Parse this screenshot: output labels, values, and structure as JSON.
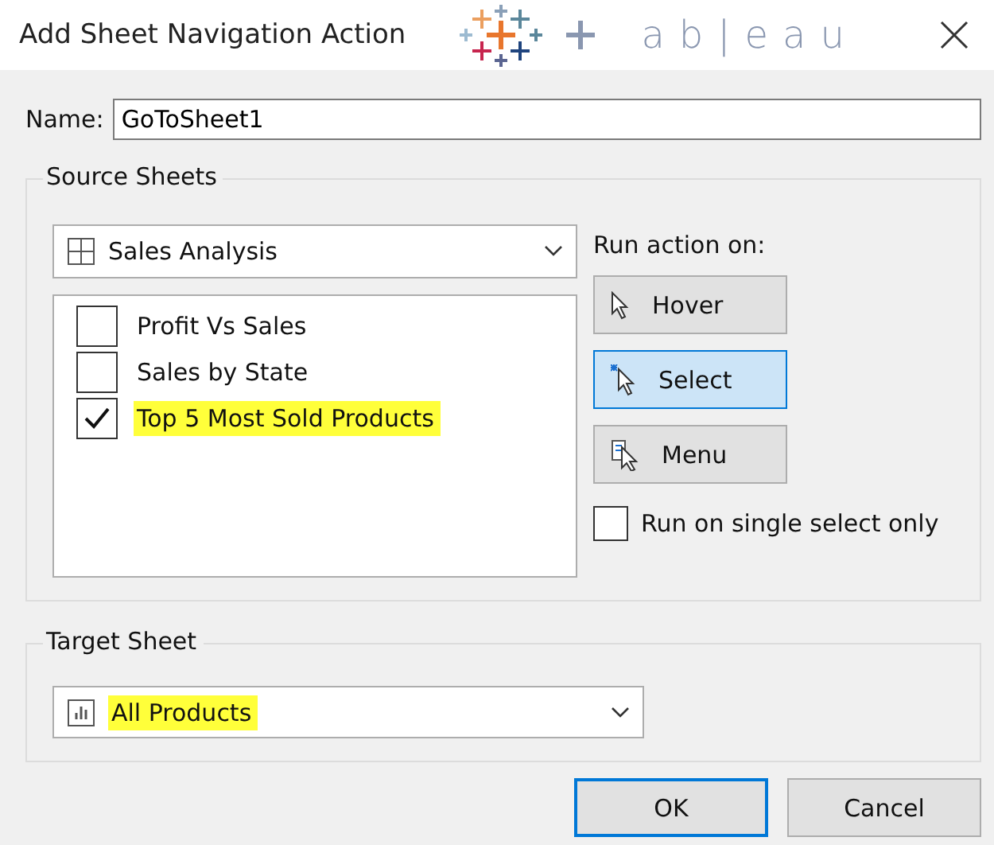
{
  "window": {
    "title": "Add Sheet Navigation Action",
    "logo_wordmark": "ab|eau"
  },
  "name_field": {
    "label": "Name:",
    "value": "GoToSheet1"
  },
  "source_sheets": {
    "title": "Source Sheets",
    "dashboard": "Sales Analysis",
    "sheets": [
      {
        "label": "Profit Vs Sales",
        "checked": false,
        "highlighted": false
      },
      {
        "label": "Sales by State",
        "checked": false,
        "highlighted": false
      },
      {
        "label": "Top 5 Most Sold Products",
        "checked": true,
        "highlighted": true
      }
    ],
    "run_action_label": "Run action on:",
    "run_options": [
      {
        "kind": "hover",
        "label": "Hover",
        "selected": false
      },
      {
        "kind": "select",
        "label": "Select",
        "selected": true
      },
      {
        "kind": "menu",
        "label": "Menu",
        "selected": false
      }
    ],
    "single_select": {
      "label": "Run on single select only",
      "checked": false
    }
  },
  "target_sheet": {
    "title": "Target Sheet",
    "value": "All Products",
    "highlighted": true
  },
  "buttons": [
    {
      "label": "OK",
      "default": true
    },
    {
      "label": "Cancel",
      "default": false
    }
  ]
}
